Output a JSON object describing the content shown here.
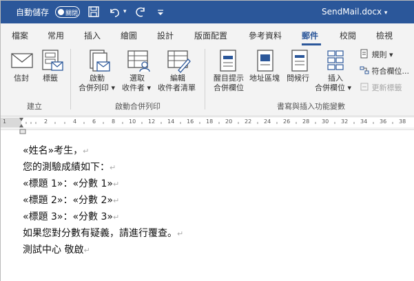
{
  "titlebar": {
    "autosave_label": "自動儲存",
    "toggle_state": "關閉",
    "save_icon": "save-icon",
    "undo_icon": "undo-icon",
    "redo_icon": "redo-icon",
    "customize_icon": "customize-icon",
    "doc_title": "SendMail.docx",
    "doc_title_arrow": "▾",
    "background": "#2b579a"
  },
  "tabs": [
    {
      "label": "檔案"
    },
    {
      "label": "常用"
    },
    {
      "label": "插入"
    },
    {
      "label": "繪圖"
    },
    {
      "label": "設計"
    },
    {
      "label": "版面配置"
    },
    {
      "label": "參考資料"
    },
    {
      "label": "郵件",
      "active": true
    },
    {
      "label": "校閱"
    },
    {
      "label": "檢視"
    }
  ],
  "ribbon": {
    "groups": [
      {
        "label": "建立",
        "buttons": [
          {
            "label": "信封",
            "icon": "envelope-icon"
          },
          {
            "label": "標籤",
            "icon": "labels-icon"
          }
        ]
      },
      {
        "label": "啟動合併列印",
        "buttons": [
          {
            "line1": "啟動",
            "line2": "合併列印 ▾",
            "icon": "start-mail-merge-icon"
          },
          {
            "line1": "選取",
            "line2": "收件者 ▾",
            "icon": "select-recipients-icon"
          },
          {
            "line1": "編輯",
            "line2": "收件者清單",
            "icon": "edit-recipient-list-icon"
          }
        ]
      },
      {
        "label": "書寫與插入功能變數",
        "buttons": [
          {
            "line1": "醒目提示",
            "line2": "合併欄位",
            "icon": "highlight-merge-fields-icon"
          },
          {
            "line1": "地址區塊",
            "line2": "",
            "icon": "address-block-icon"
          },
          {
            "line1": "問候行",
            "line2": "",
            "icon": "greeting-line-icon"
          },
          {
            "line1": "插入",
            "line2": "合併欄位 ▾",
            "icon": "insert-merge-field-icon"
          }
        ],
        "small_items": [
          {
            "label": "規則 ▾",
            "icon": "rules-icon",
            "disabled": false
          },
          {
            "label": "符合欄位...",
            "icon": "match-fields-icon",
            "disabled": false
          },
          {
            "label": "更新標籤",
            "icon": "update-labels-icon",
            "disabled": true
          }
        ]
      }
    ]
  },
  "ruler": {
    "numbers": [
      "1",
      "2",
      "4",
      "6",
      "8",
      "10",
      "12",
      "14",
      "16",
      "18",
      "20",
      "22",
      "24",
      "26",
      "28",
      "30",
      "32",
      "34",
      "36",
      "38"
    ]
  },
  "document": {
    "lines": [
      "«姓名»考生，",
      "您的測驗成績如下：",
      "«標題 1»：«分數 1»",
      "«標題 2»：«分數 2»",
      "«標題 3»：«分數 3»",
      "如果您對分數有疑義，請進行覆查。",
      "測試中心 敬啟"
    ],
    "paragraph_mark": "↵"
  }
}
